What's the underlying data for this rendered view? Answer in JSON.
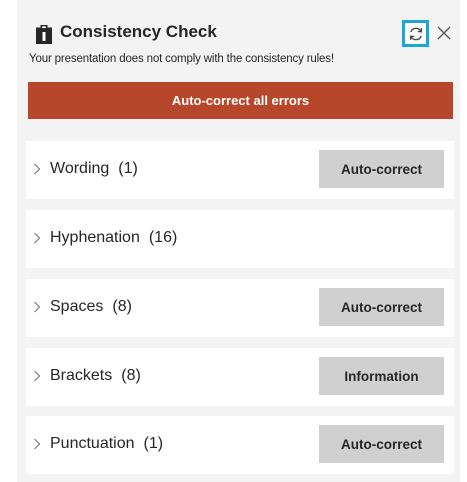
{
  "header": {
    "title": "Consistency Check",
    "subtitle": "Your presentation does not comply with the consistency rules!",
    "title_icon": "clipboard-icon",
    "refresh_icon": "refresh-icon",
    "close_icon": "close-icon"
  },
  "autofix_all_label": "Auto-correct all errors",
  "rules": [
    {
      "name": "Wording",
      "count": "(1)",
      "action": "Auto-correct"
    },
    {
      "name": "Hyphenation",
      "count": "(16)",
      "action": null
    },
    {
      "name": "Spaces",
      "count": "(8)",
      "action": "Auto-correct"
    },
    {
      "name": "Brackets",
      "count": "(8)",
      "action": "Information"
    },
    {
      "name": "Punctuation",
      "count": "(1)",
      "action": "Auto-correct"
    }
  ],
  "colors": {
    "accent": "#b7472a",
    "highlight": "#1aa6d6",
    "panel_bg": "#f3f3f3",
    "button_bg": "#d0d0d0"
  }
}
